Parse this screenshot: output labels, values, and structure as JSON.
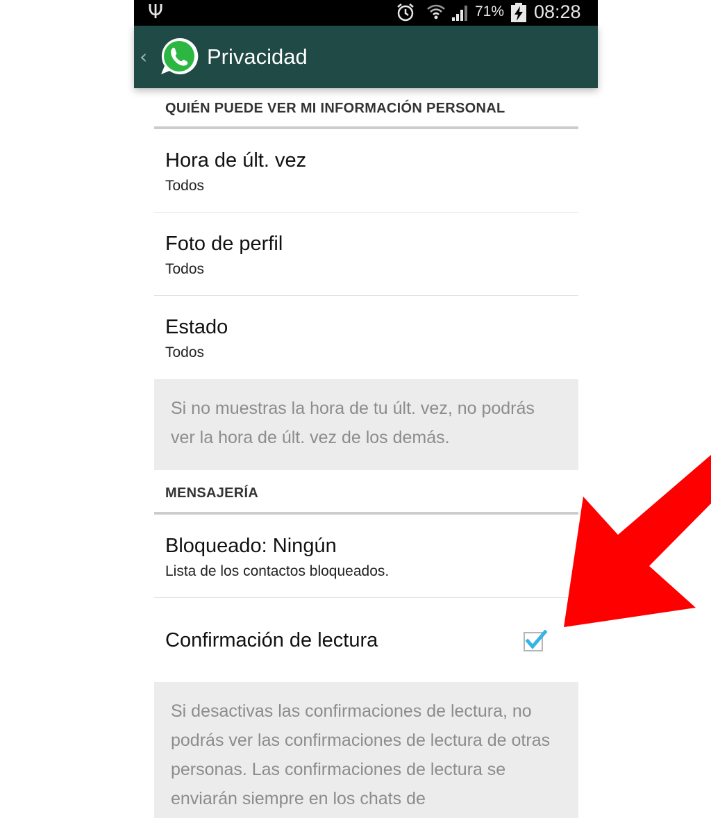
{
  "status_bar": {
    "usb_icon": "usb-icon",
    "battery_percent": "71%",
    "time": "08:28"
  },
  "action_bar": {
    "back_icon": "‹",
    "title": "Privacidad",
    "bar_color": "#1f4a46"
  },
  "section_personal": {
    "header": "QUIÉN PUEDE VER MI INFORMACIÓN PERSONAL",
    "items": [
      {
        "title": "Hora de últ. vez",
        "summary": "Todos"
      },
      {
        "title": "Foto de perfil",
        "summary": "Todos"
      },
      {
        "title": "Estado",
        "summary": "Todos"
      }
    ],
    "info": "Si no muestras la hora de tu últ. vez, no podrás ver la hora de últ. vez de los demás."
  },
  "section_messaging": {
    "header": "MENSAJERÍA",
    "blocked": {
      "title": "Bloqueado: Ningún",
      "summary": "Lista de los contactos bloqueados."
    },
    "read_receipts": {
      "title": "Confirmación de lectura",
      "checked": true
    },
    "info": "Si desactivas las confirmaciones de lectura, no podrás ver las confirmaciones de lectura de otras personas. Las confirmaciones de lectura se enviarán siempre en los chats de"
  },
  "colors": {
    "accent_check": "#33b5e5",
    "arrow": "#ff0000",
    "whatsapp_green": "#2bb741"
  }
}
